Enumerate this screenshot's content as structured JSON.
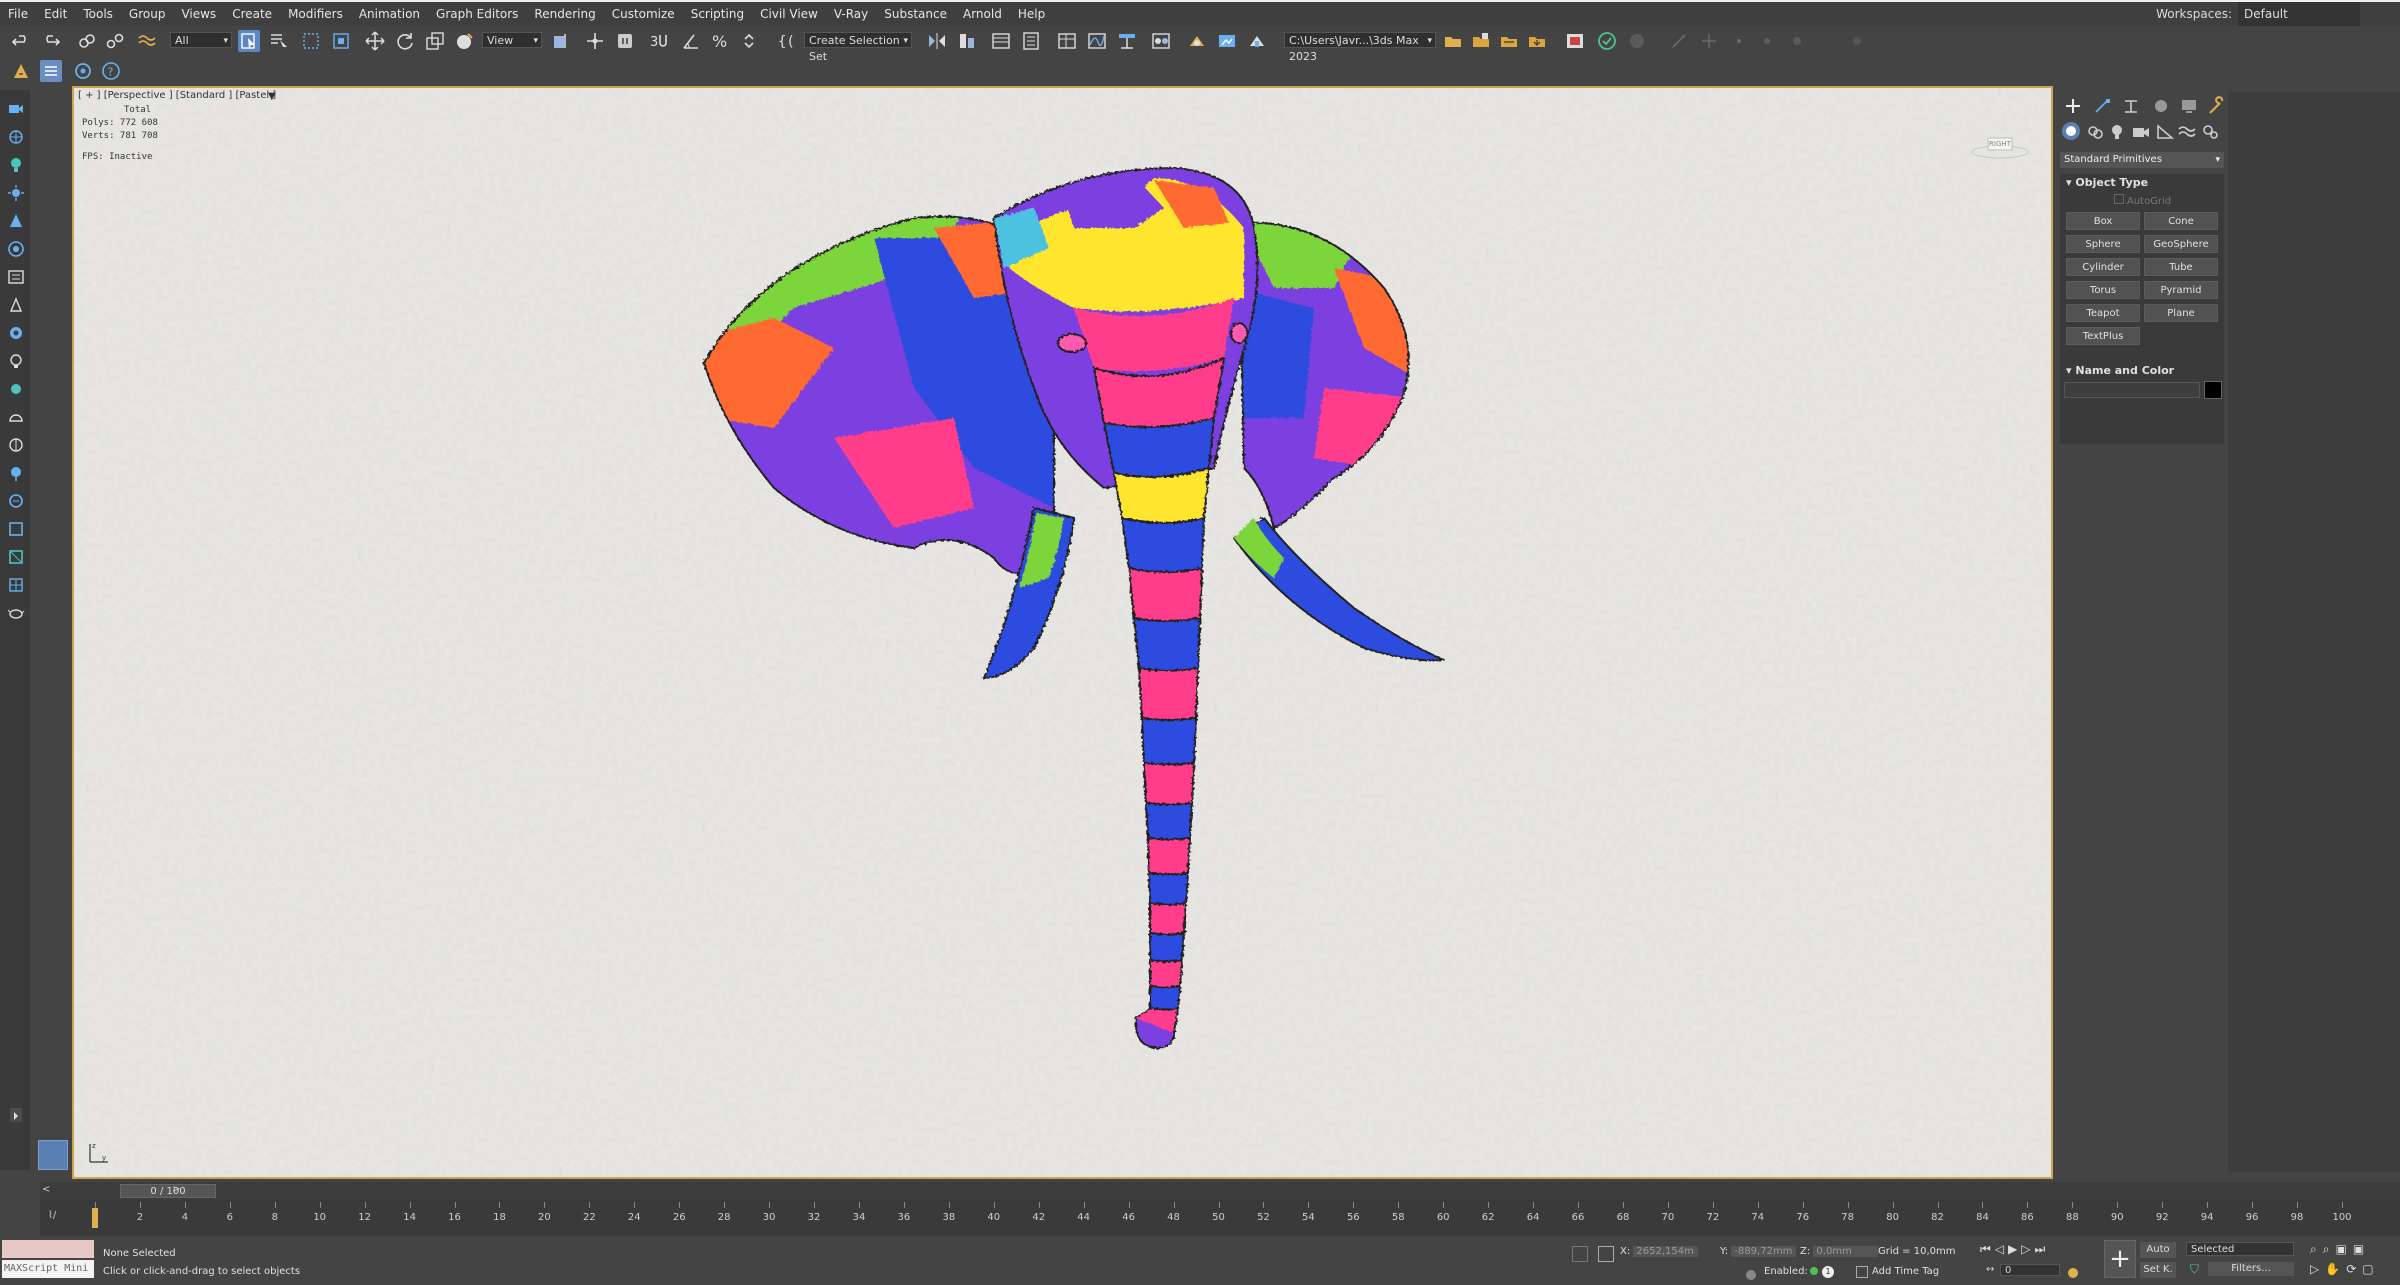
{
  "menu": [
    "File",
    "Edit",
    "Tools",
    "Group",
    "Views",
    "Create",
    "Modifiers",
    "Animation",
    "Graph Editors",
    "Rendering",
    "Customize",
    "Scripting",
    "Civil View",
    "V-Ray",
    "Substance",
    "Arnold",
    "Help"
  ],
  "workspaces": {
    "label": "Workspaces:",
    "value": "Default"
  },
  "toolbar": {
    "selection_filter": "All",
    "reference_coord": "View",
    "named_selection": "Create Selection Set",
    "project_path": "C:\\Users\\Javr...\\3ds Max 2023"
  },
  "viewport": {
    "label": "[ + ] [Perspective ] [Standard ] [Pastel ]",
    "stats": {
      "total_label": "Total",
      "polys": "Polys:  772 608",
      "verts": "Verts:  781 708",
      "fps": "FPS:   Inactive"
    },
    "viewcube_label": "RIGHT"
  },
  "command_panel": {
    "category": "Standard Primitives",
    "object_type_title": "Object Type",
    "autogrid": "AutoGrid",
    "buttons": [
      "Box",
      "Cone",
      "Sphere",
      "GeoSphere",
      "Cylinder",
      "Tube",
      "Torus",
      "Pyramid",
      "Teapot",
      "Plane",
      "TextPlus"
    ],
    "name_color_title": "Name and Color",
    "object_color": "#000000"
  },
  "timeline": {
    "slider": "0 / 100",
    "ticks": [
      "0",
      "2",
      "4",
      "6",
      "8",
      "10",
      "12",
      "14",
      "16",
      "18",
      "20",
      "22",
      "24",
      "26",
      "28",
      "30",
      "32",
      "34",
      "36",
      "38",
      "40",
      "42",
      "44",
      "46",
      "48",
      "50",
      "52",
      "54",
      "56",
      "58",
      "60",
      "62",
      "64",
      "66",
      "68",
      "70",
      "72",
      "74",
      "76",
      "78",
      "80",
      "82",
      "84",
      "86",
      "88",
      "90",
      "92",
      "94",
      "96",
      "98",
      "100"
    ]
  },
  "status": {
    "maxscript": "MAXScript Mini",
    "selection": "None Selected",
    "prompt": "Click or click-and-drag to select objects",
    "x_label": "X:",
    "x_value": "2652,154m",
    "y_label": "Y:",
    "y_value": "-889,72mm",
    "z_label": "Z:",
    "z_value": "0,0mm",
    "grid": "Grid = 10,0mm",
    "enabled": "Enabled:",
    "add_time_tag": "Add Time Tag",
    "auto": "Auto",
    "set_key": "Set K.",
    "key_filter": "Selected",
    "filters": "Filters...",
    "frame": "0"
  },
  "colors": {
    "viewport_border": "#c8a64b",
    "accent": "#4a8fd4"
  }
}
